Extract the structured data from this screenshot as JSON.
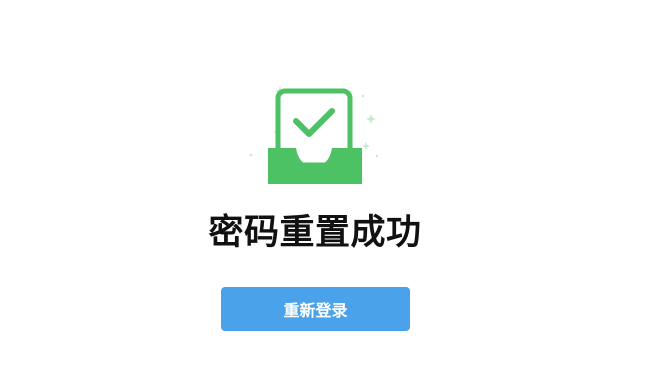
{
  "result": {
    "title": "密码重置成功",
    "icon": "success-inbox-check-icon",
    "accent_color": "#4cc265"
  },
  "actions": {
    "relogin_label": "重新登录",
    "button_color": "#4aa2ea"
  }
}
